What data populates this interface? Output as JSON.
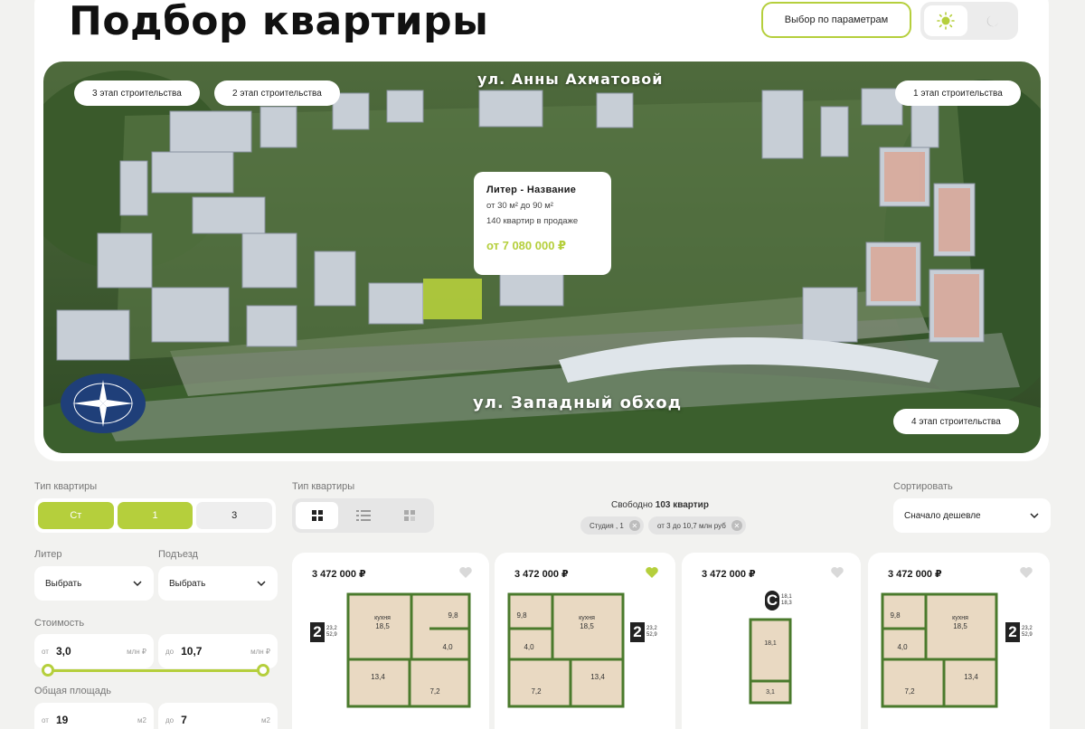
{
  "header": {
    "title": "Подбор квартиры",
    "param_button": "Выбор по параметрам",
    "theme": {
      "light_icon": "sun-icon",
      "dark_icon": "moon-icon",
      "active": "light"
    }
  },
  "map": {
    "street_top": "ул. Анны Ахматовой",
    "street_bottom": "ул. Западный обход",
    "stages": {
      "stage3": "3 этап строительства",
      "stage2": "2 этап строительства",
      "stage1": "1 этап строительства",
      "stage4": "4 этап строительства"
    },
    "popup": {
      "title": "Литер - Название",
      "area_range": "от 30 м² до 90 м²",
      "on_sale": "140 квартир в продаже",
      "price": "от 7 080 000 ₽"
    }
  },
  "filters": {
    "type_label": "Тип квартиры",
    "type_options": [
      "Ст",
      "1",
      "3"
    ],
    "type_active": [
      0,
      1
    ],
    "view_label": "Тип квартиры",
    "view_icons": [
      "grid-icon",
      "list-icon",
      "plan-icon"
    ],
    "free_prefix": "Свободно",
    "free_count": "103 квартир",
    "chips": [
      "Студия , 1",
      "от 3 до 10,7 млн руб"
    ],
    "sort_label": "Сортировать",
    "sort_value": "Сначало дешевле",
    "liter_label": "Литер",
    "liter_value": "Выбрать",
    "entrance_label": "Подъезд",
    "entrance_value": "Выбрать",
    "cost_label": "Стоимость",
    "cost_from_prefix": "от",
    "cost_from": "3,0",
    "cost_to_prefix": "до",
    "cost_to": "10,7",
    "cost_unit": "млн ₽",
    "area_label": "Общая площадь",
    "area_from_prefix": "от",
    "area_from": "19",
    "area_to_prefix": "до",
    "area_to": "7",
    "area_unit": "м2"
  },
  "cards": [
    {
      "price": "3 472 000 ₽",
      "favorite": false,
      "rooms": "2",
      "area1": "23,2",
      "area2": "52,9"
    },
    {
      "price": "3 472 000 ₽",
      "favorite": true,
      "rooms": "2",
      "area1": "23,2",
      "area2": "52,9"
    },
    {
      "price": "3 472 000 ₽",
      "favorite": false,
      "rooms": "С",
      "area1": "18,1",
      "area2": "18,3"
    },
    {
      "price": "3 472 000 ₽",
      "favorite": false,
      "rooms": "2",
      "area1": "23,2",
      "area2": "52,9"
    }
  ],
  "plan_labels": {
    "kitchen": "кухня",
    "r18": "18,5",
    "r98": "9,8",
    "r40": "4,0",
    "r134": "13,4",
    "r72": "7,2",
    "s181": "18,1",
    "s31": "3,1"
  },
  "colors": {
    "accent": "#b5cf3c",
    "plan_wall": "#4a7a2c",
    "plan_floor": "#e9d9c2"
  }
}
